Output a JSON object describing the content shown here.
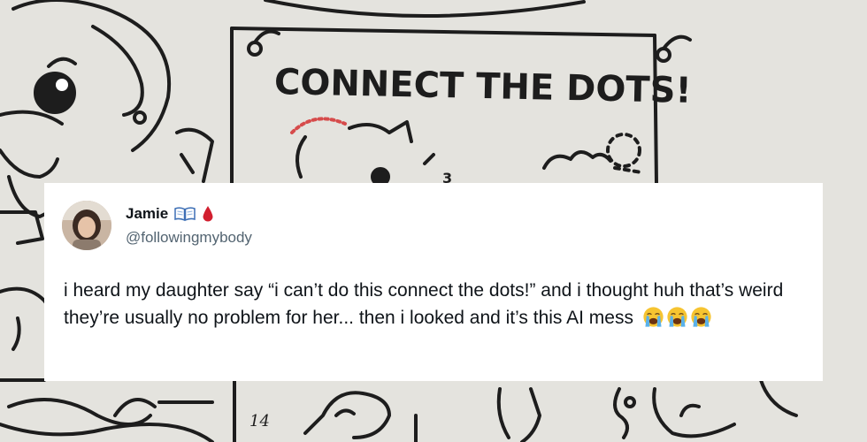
{
  "background": {
    "sign_title": "CONNECT THE DOTS!",
    "dot_number_1": "3",
    "dot_number_2": "14"
  },
  "tweet": {
    "author": {
      "display_name": "Jamie",
      "handle": "@followingmybody",
      "badges": [
        "open-book-icon",
        "drop-of-blood-icon"
      ]
    },
    "text": "i heard my daughter say “i can’t do this connect the dots!” and i thought huh that’s weird they’re usually no problem for her... then i looked and it’s this AI mess",
    "emojis": [
      "loudly-crying-face-icon",
      "loudly-crying-face-icon",
      "loudly-crying-face-icon"
    ]
  },
  "colors": {
    "card_background": "#ffffff",
    "text_primary": "#0f1419",
    "text_secondary": "#536471",
    "blood_drop": "#d21f2f",
    "emoji_yellow": "#f6c431",
    "tears_blue": "#5ab1ea"
  }
}
